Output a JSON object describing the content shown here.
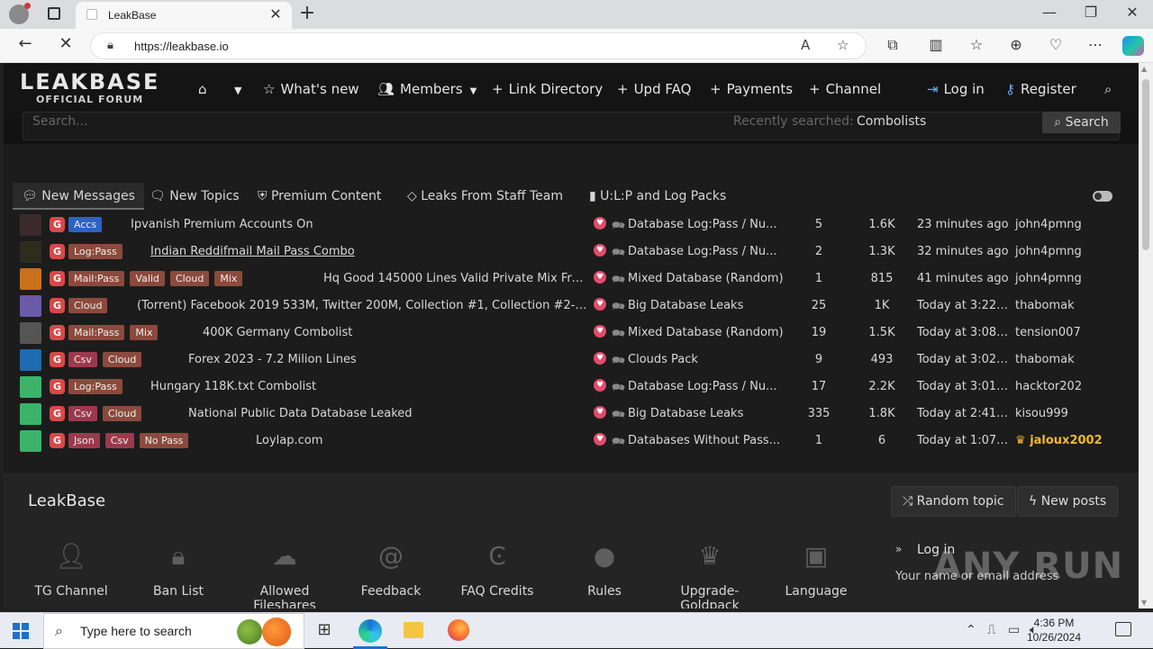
{
  "browser": {
    "tab_title": "LeakBase",
    "url": "https://leakbase.io",
    "new_tab": "+",
    "tab_close": "✕"
  },
  "header": {
    "logo_main": "LEAKBASE",
    "logo_sub": "OFFICIAL FORUM",
    "nav": {
      "whats_new": "What's new",
      "members": "Members",
      "link_directory": "Link Directory",
      "upd_faq": "Upd FAQ",
      "payments": "Payments",
      "channel": "Channel",
      "login": "Log in",
      "register": "Register"
    }
  },
  "search": {
    "placeholder": "Search...",
    "recent_label": "Recently searched:",
    "recent_value": "Combolists",
    "button": "Search"
  },
  "tabs": [
    "New Messages",
    "New Topics",
    "Premium Content",
    "Leaks From Staff Team",
    "U:L:P and Log Packs"
  ],
  "threads": [
    {
      "badges": [
        {
          "text": "Accs",
          "style": "blue"
        }
      ],
      "title": "Ipvanish Premium Accounts On",
      "forum": "Database Log:Pass / Nu...",
      "replies": "5",
      "views": "1.6K",
      "time": "23 minutes ago",
      "user": "john4pmng"
    },
    {
      "badges": [
        {
          "text": "Log:Pass",
          "style": "brown"
        }
      ],
      "title": "Indian Reddifmail Mail Pass Combo",
      "forum": "Database Log:Pass / Nu...",
      "replies": "2",
      "views": "1.3K",
      "time": "32 minutes ago",
      "user": "john4pmng"
    },
    {
      "badges": [
        {
          "text": "Mail:Pass",
          "style": "brown"
        },
        {
          "text": "Valid",
          "style": "brown"
        },
        {
          "text": "Cloud",
          "style": "brown"
        },
        {
          "text": "Mix",
          "style": "brown"
        }
      ],
      "title": "Hq Good 145000 Lines Valid Private Mix Free ...",
      "forum": "Mixed Database (Random)",
      "replies": "1",
      "views": "815",
      "time": "41 minutes ago",
      "user": "john4pmng"
    },
    {
      "badges": [
        {
          "text": "Cloud",
          "style": "brown"
        }
      ],
      "title": "(Torrent) Facebook 2019 533M, Twitter 200M, Collection #1, Collection #2-5, Na...",
      "forum": "Big Database Leaks",
      "replies": "25",
      "views": "1K",
      "time": "Today at 3:22 P...",
      "user": "thabomak"
    },
    {
      "badges": [
        {
          "text": "Mail:Pass",
          "style": "brown"
        },
        {
          "text": "Mix",
          "style": "brown"
        }
      ],
      "title": "400K Germany Combolist",
      "forum": "Mixed Database (Random)",
      "replies": "19",
      "views": "1.5K",
      "time": "Today at 3:08 P...",
      "user": "tension007"
    },
    {
      "badges": [
        {
          "text": "Csv",
          "style": "pink"
        },
        {
          "text": "Cloud",
          "style": "brown"
        }
      ],
      "title": "Forex 2023 - 7.2 Milion Lines",
      "forum": "Clouds Pack",
      "replies": "9",
      "views": "493",
      "time": "Today at 3:02 P...",
      "user": "thabomak"
    },
    {
      "badges": [
        {
          "text": "Log:Pass",
          "style": "brown"
        }
      ],
      "title": "Hungary 118K.txt Combolist",
      "forum": "Database Log:Pass / Nu...",
      "replies": "17",
      "views": "2.2K",
      "time": "Today at 3:01 P...",
      "user": "hacktor202"
    },
    {
      "badges": [
        {
          "text": "Csv",
          "style": "pink"
        },
        {
          "text": "Cloud",
          "style": "brown"
        }
      ],
      "title": "National Public Data Database Leaked",
      "forum": "Big Database Leaks",
      "replies": "335",
      "views": "1.8K",
      "time": "Today at 2:41 P...",
      "user": "kisou999"
    },
    {
      "badges": [
        {
          "text": "Json",
          "style": "pink"
        },
        {
          "text": "Csv",
          "style": "pink"
        },
        {
          "text": "No Pass",
          "style": "brown"
        }
      ],
      "title": "Loylap.com",
      "forum": "Databases Without Pass...",
      "replies": "1",
      "views": "6",
      "time": "Today at 1:07 P...",
      "user": "jaloux2002"
    }
  ],
  "footer": {
    "site_name": "LeakBase",
    "random_topic": "Random topic",
    "new_posts": "New posts",
    "icons": [
      "TG Channel",
      "Ban List",
      "Allowed Fileshares",
      "Feedback",
      "FAQ Credits",
      "Rules",
      "Upgrade-Goldpack",
      "Language"
    ],
    "login_title": "Log in",
    "login_field_label": "Your name or email address"
  },
  "watermark": "ANY RUN",
  "taskbar": {
    "search_text": "Type here to search",
    "time": "4:36 PM",
    "date": "10/26/2024"
  }
}
